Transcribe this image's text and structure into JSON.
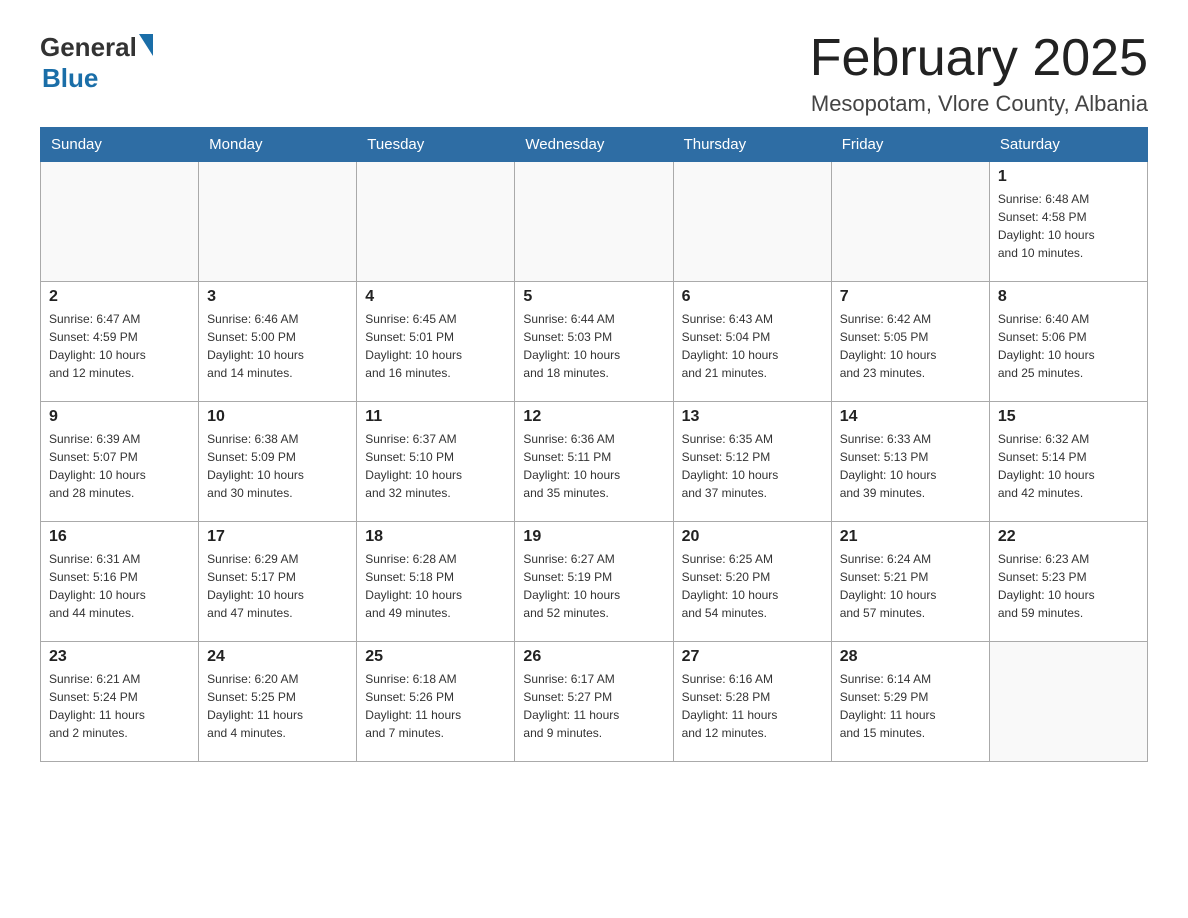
{
  "header": {
    "logo_general": "General",
    "logo_blue": "Blue",
    "month_title": "February 2025",
    "location": "Mesopotam, Vlore County, Albania"
  },
  "weekdays": [
    "Sunday",
    "Monday",
    "Tuesday",
    "Wednesday",
    "Thursday",
    "Friday",
    "Saturday"
  ],
  "weeks": [
    [
      {
        "day": "",
        "info": ""
      },
      {
        "day": "",
        "info": ""
      },
      {
        "day": "",
        "info": ""
      },
      {
        "day": "",
        "info": ""
      },
      {
        "day": "",
        "info": ""
      },
      {
        "day": "",
        "info": ""
      },
      {
        "day": "1",
        "info": "Sunrise: 6:48 AM\nSunset: 4:58 PM\nDaylight: 10 hours\nand 10 minutes."
      }
    ],
    [
      {
        "day": "2",
        "info": "Sunrise: 6:47 AM\nSunset: 4:59 PM\nDaylight: 10 hours\nand 12 minutes."
      },
      {
        "day": "3",
        "info": "Sunrise: 6:46 AM\nSunset: 5:00 PM\nDaylight: 10 hours\nand 14 minutes."
      },
      {
        "day": "4",
        "info": "Sunrise: 6:45 AM\nSunset: 5:01 PM\nDaylight: 10 hours\nand 16 minutes."
      },
      {
        "day": "5",
        "info": "Sunrise: 6:44 AM\nSunset: 5:03 PM\nDaylight: 10 hours\nand 18 minutes."
      },
      {
        "day": "6",
        "info": "Sunrise: 6:43 AM\nSunset: 5:04 PM\nDaylight: 10 hours\nand 21 minutes."
      },
      {
        "day": "7",
        "info": "Sunrise: 6:42 AM\nSunset: 5:05 PM\nDaylight: 10 hours\nand 23 minutes."
      },
      {
        "day": "8",
        "info": "Sunrise: 6:40 AM\nSunset: 5:06 PM\nDaylight: 10 hours\nand 25 minutes."
      }
    ],
    [
      {
        "day": "9",
        "info": "Sunrise: 6:39 AM\nSunset: 5:07 PM\nDaylight: 10 hours\nand 28 minutes."
      },
      {
        "day": "10",
        "info": "Sunrise: 6:38 AM\nSunset: 5:09 PM\nDaylight: 10 hours\nand 30 minutes."
      },
      {
        "day": "11",
        "info": "Sunrise: 6:37 AM\nSunset: 5:10 PM\nDaylight: 10 hours\nand 32 minutes."
      },
      {
        "day": "12",
        "info": "Sunrise: 6:36 AM\nSunset: 5:11 PM\nDaylight: 10 hours\nand 35 minutes."
      },
      {
        "day": "13",
        "info": "Sunrise: 6:35 AM\nSunset: 5:12 PM\nDaylight: 10 hours\nand 37 minutes."
      },
      {
        "day": "14",
        "info": "Sunrise: 6:33 AM\nSunset: 5:13 PM\nDaylight: 10 hours\nand 39 minutes."
      },
      {
        "day": "15",
        "info": "Sunrise: 6:32 AM\nSunset: 5:14 PM\nDaylight: 10 hours\nand 42 minutes."
      }
    ],
    [
      {
        "day": "16",
        "info": "Sunrise: 6:31 AM\nSunset: 5:16 PM\nDaylight: 10 hours\nand 44 minutes."
      },
      {
        "day": "17",
        "info": "Sunrise: 6:29 AM\nSunset: 5:17 PM\nDaylight: 10 hours\nand 47 minutes."
      },
      {
        "day": "18",
        "info": "Sunrise: 6:28 AM\nSunset: 5:18 PM\nDaylight: 10 hours\nand 49 minutes."
      },
      {
        "day": "19",
        "info": "Sunrise: 6:27 AM\nSunset: 5:19 PM\nDaylight: 10 hours\nand 52 minutes."
      },
      {
        "day": "20",
        "info": "Sunrise: 6:25 AM\nSunset: 5:20 PM\nDaylight: 10 hours\nand 54 minutes."
      },
      {
        "day": "21",
        "info": "Sunrise: 6:24 AM\nSunset: 5:21 PM\nDaylight: 10 hours\nand 57 minutes."
      },
      {
        "day": "22",
        "info": "Sunrise: 6:23 AM\nSunset: 5:23 PM\nDaylight: 10 hours\nand 59 minutes."
      }
    ],
    [
      {
        "day": "23",
        "info": "Sunrise: 6:21 AM\nSunset: 5:24 PM\nDaylight: 11 hours\nand 2 minutes."
      },
      {
        "day": "24",
        "info": "Sunrise: 6:20 AM\nSunset: 5:25 PM\nDaylight: 11 hours\nand 4 minutes."
      },
      {
        "day": "25",
        "info": "Sunrise: 6:18 AM\nSunset: 5:26 PM\nDaylight: 11 hours\nand 7 minutes."
      },
      {
        "day": "26",
        "info": "Sunrise: 6:17 AM\nSunset: 5:27 PM\nDaylight: 11 hours\nand 9 minutes."
      },
      {
        "day": "27",
        "info": "Sunrise: 6:16 AM\nSunset: 5:28 PM\nDaylight: 11 hours\nand 12 minutes."
      },
      {
        "day": "28",
        "info": "Sunrise: 6:14 AM\nSunset: 5:29 PM\nDaylight: 11 hours\nand 15 minutes."
      },
      {
        "day": "",
        "info": ""
      }
    ]
  ]
}
